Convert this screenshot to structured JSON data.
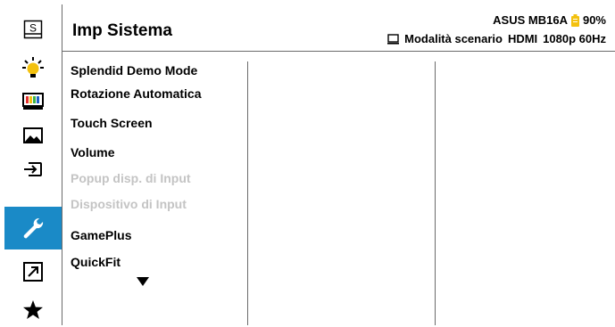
{
  "header": {
    "title": "Imp Sistema",
    "model": "ASUS MB16A",
    "battery": "90%",
    "mode": "Modalità scenario",
    "input": "HDMI",
    "resolution": "1080p 60Hz"
  },
  "sidebar": {
    "items": [
      {
        "name": "splendid",
        "icon": "splendid-s-icon"
      },
      {
        "name": "blue-light-filter",
        "icon": "bulb-icon"
      },
      {
        "name": "color",
        "icon": "color-bars-icon"
      },
      {
        "name": "image",
        "icon": "image-icon"
      },
      {
        "name": "input-select",
        "icon": "input-icon"
      },
      {
        "name": "system-setup",
        "icon": "wrench-icon",
        "active": true
      },
      {
        "name": "shortcut",
        "icon": "arrow-icon"
      },
      {
        "name": "myfavorite",
        "icon": "star-icon"
      }
    ]
  },
  "menu": {
    "items": [
      {
        "label": "Splendid Demo Mode",
        "enabled": true
      },
      {
        "label": "Rotazione Automatica",
        "enabled": true
      },
      {
        "label": "Touch Screen",
        "enabled": true
      },
      {
        "label": "Volume",
        "enabled": true
      },
      {
        "label": "Popup disp. di Input",
        "enabled": false
      },
      {
        "label": "Dispositivo di Input",
        "enabled": false
      },
      {
        "label": "GamePlus",
        "enabled": true
      },
      {
        "label": "QuickFit",
        "enabled": true
      }
    ],
    "more_icon": "arrow-down-icon"
  },
  "colors": {
    "accent": "#1a8ac7",
    "battery": "#f3c10f",
    "disabled_text": "#c4c4c4",
    "divider": "#6b6b6b"
  }
}
